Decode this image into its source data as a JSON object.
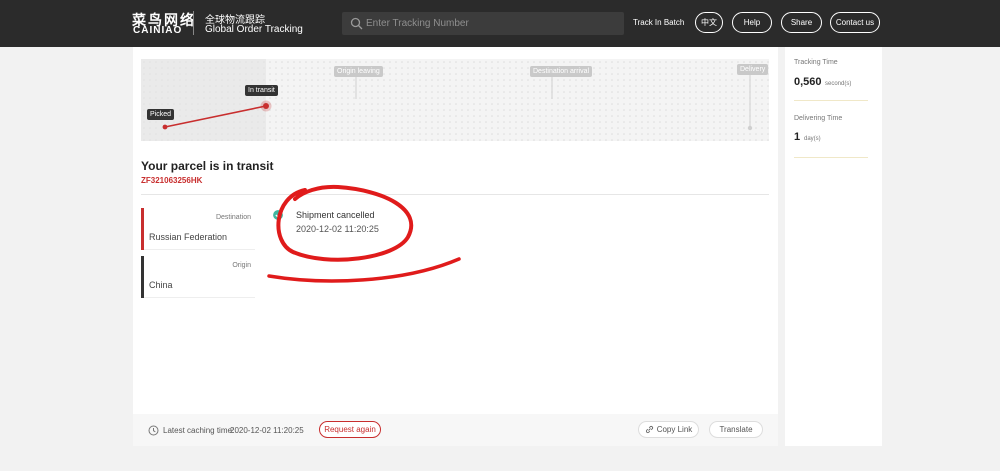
{
  "header": {
    "logo_cn": "菜鸟网络",
    "logo_en": "CAINIAO",
    "subtitle_cn": "全球物流跟踪",
    "subtitle_en": "Global Order Tracking",
    "search_placeholder": "Enter Tracking Number",
    "track_batch": "Track In Batch",
    "lang_button": "中文",
    "help_button": "Help",
    "share_button": "Share",
    "contact_button": "Contact us",
    "bg_color": "#2b2b2b"
  },
  "map": {
    "picked_label": "Picked",
    "in_transit_label": "In transit",
    "origin_leaving_label": "Origin leaving",
    "destination_arrival_label": "Destination arrival",
    "delivery_label": "Delivery",
    "route_color": "#c82e2e"
  },
  "parcel": {
    "status_title": "Your parcel is in transit",
    "tracking_number": "ZF321063256HK",
    "accent_color": "#c82e2e"
  },
  "locations": {
    "destination_label": "Destination",
    "destination_value": "Russian Federation",
    "origin_label": "Origin",
    "origin_value": "China"
  },
  "events": [
    {
      "text": "Shipment cancelled",
      "time": "2020-12-02 11:20:25",
      "icon": "check-icon"
    }
  ],
  "footer": {
    "cache_label": "Latest caching time:",
    "cache_time": "2020-12-02 11:20:25",
    "request_again": "Request again",
    "copy_link": "Copy Link",
    "translate": "Translate"
  },
  "stats": {
    "tracking_time_label": "Tracking Time",
    "tracking_time_value": "0,560",
    "tracking_time_unit": "second(s)",
    "delivering_time_label": "Delivering Time",
    "delivering_time_value": "1",
    "delivering_time_unit": "day(s)"
  }
}
